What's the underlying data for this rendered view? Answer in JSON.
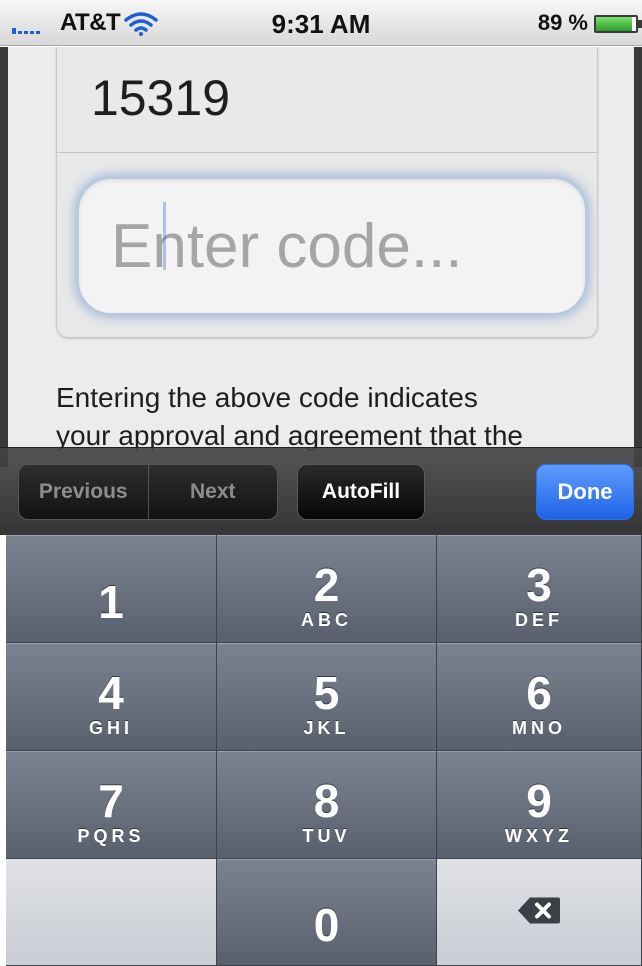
{
  "status_bar": {
    "carrier": "AT&T",
    "time": "9:31 AM",
    "battery_percent": "89 %",
    "battery_level": 0.89,
    "wifi_icon": "wifi-icon",
    "signal_icon": "signal-bars-icon"
  },
  "form": {
    "code_number": "15319",
    "code_input_value": "",
    "code_input_placeholder": "Enter code...",
    "disclaimer_line_1": "Entering the above code indicates",
    "disclaimer_line_2": "your approval and agreement that the"
  },
  "accessory_toolbar": {
    "previous_label": "Previous",
    "next_label": "Next",
    "autofill_label": "AutoFill",
    "done_label": "Done",
    "done_color": "#2a6ff0"
  },
  "keypad": {
    "keys": [
      {
        "digit": "1",
        "letters": ""
      },
      {
        "digit": "2",
        "letters": "ABC"
      },
      {
        "digit": "3",
        "letters": "DEF"
      },
      {
        "digit": "4",
        "letters": "GHI"
      },
      {
        "digit": "5",
        "letters": "JKL"
      },
      {
        "digit": "6",
        "letters": "MNO"
      },
      {
        "digit": "7",
        "letters": "PQRS"
      },
      {
        "digit": "8",
        "letters": "TUV"
      },
      {
        "digit": "9",
        "letters": "WXYZ"
      },
      {
        "digit": "0",
        "letters": ""
      }
    ],
    "delete_icon": "backspace-icon"
  }
}
